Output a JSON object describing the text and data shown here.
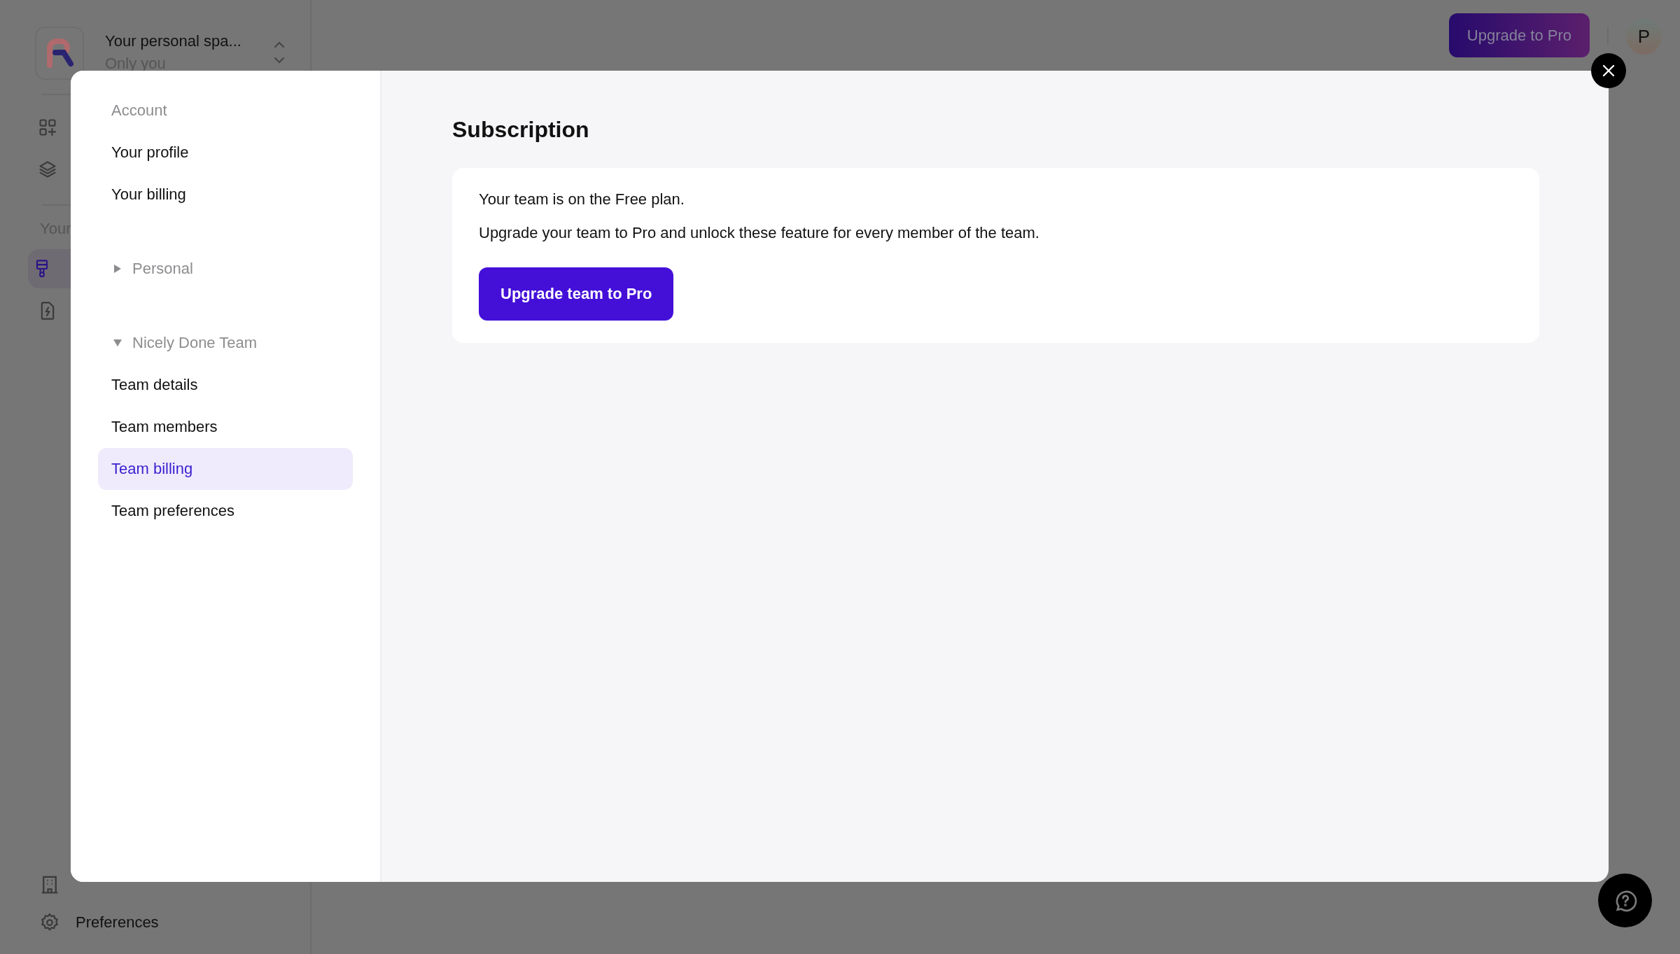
{
  "workspace": {
    "name": "Your personal spa...",
    "subtitle": "Only you"
  },
  "sidebar": {
    "top_items": [
      {
        "selected": false
      },
      {
        "selected": false
      }
    ],
    "section_label": "Your",
    "project_items": [
      {
        "selected": true
      },
      {
        "selected": false
      }
    ],
    "bottom_items": [
      {
        "kind": "icon"
      },
      {
        "kind": "link",
        "label": "Preferences"
      }
    ]
  },
  "header": {
    "upgrade_button": "Upgrade to Pro",
    "avatar": "P"
  },
  "settings_dialog": {
    "nav": [
      {
        "kind": "heading",
        "label": "Account",
        "children": [
          {
            "label": "Your profile",
            "selected": false
          },
          {
            "label": "Your billing",
            "selected": false
          }
        ]
      },
      {
        "kind": "group",
        "label": "Personal",
        "expanded": false
      },
      {
        "kind": "group",
        "label": "Nicely Done Team",
        "expanded": true,
        "children": [
          {
            "label": "Team details",
            "selected": false
          },
          {
            "label": "Team members",
            "selected": false
          },
          {
            "label": "Team billing",
            "selected": true
          },
          {
            "label": "Team preferences",
            "selected": false
          }
        ]
      }
    ],
    "title": "Subscription",
    "card": {
      "status": "Your team is on the Free plan.",
      "description": "Upgrade your team to Pro and unlock these feature for every member of the team.",
      "button": "Upgrade team to Pro"
    }
  }
}
